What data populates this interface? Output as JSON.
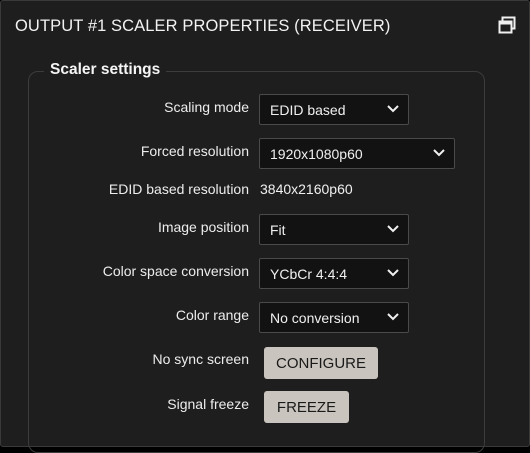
{
  "panel": {
    "title": "OUTPUT #1 SCALER PROPERTIES (RECEIVER)",
    "maximize_icon": "window-restore-icon"
  },
  "scaler_settings": {
    "legend": "Scaler settings",
    "scaling_mode": {
      "label": "Scaling mode",
      "value": "EDID based"
    },
    "forced_resolution": {
      "label": "Forced resolution",
      "value": "1920x1080p60"
    },
    "edid_based_resolution": {
      "label": "EDID based resolution",
      "value": "3840x2160p60"
    },
    "image_position": {
      "label": "Image position",
      "value": "Fit"
    },
    "color_space_conversion": {
      "label": "Color space conversion",
      "value": "YCbCr 4:4:4"
    },
    "color_range": {
      "label": "Color range",
      "value": "No conversion"
    },
    "no_sync_screen": {
      "label": "No sync screen",
      "button": "CONFIGURE"
    },
    "signal_freeze": {
      "label": "Signal freeze",
      "button": "FREEZE"
    }
  },
  "colors": {
    "panel_bg": "#1e1e1e",
    "select_bg": "#121212",
    "button_bg": "#c9c4bd",
    "text": "#f0f0f0"
  }
}
